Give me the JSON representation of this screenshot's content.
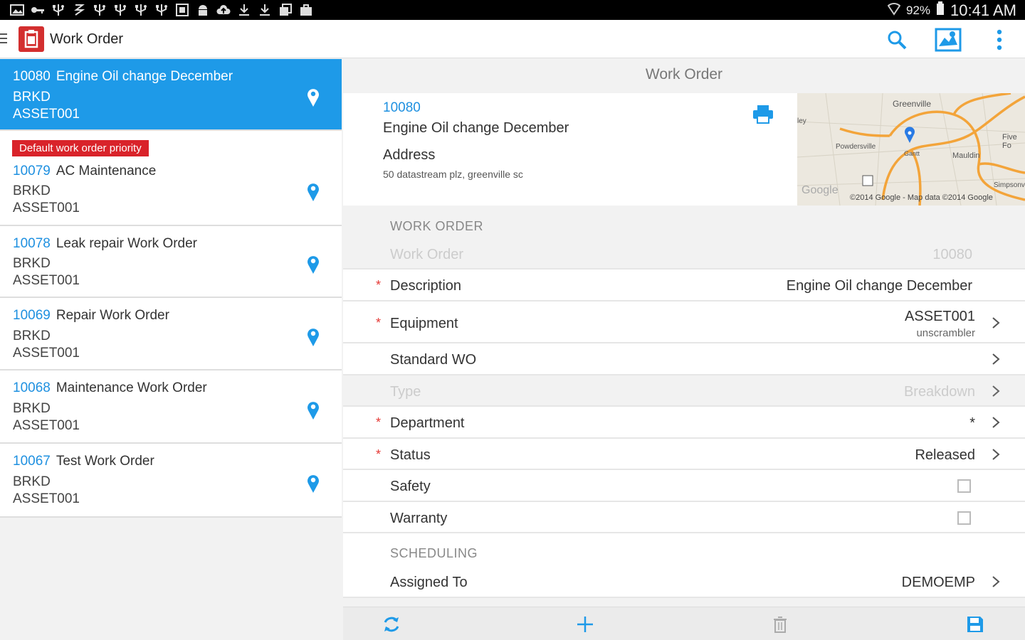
{
  "statusbar": {
    "icons": [
      "gallery-icon",
      "key-icon",
      "usb-icon",
      "signal-icon",
      "usb-icon",
      "usb-icon",
      "usb-icon",
      "usb-icon",
      "screenshot-icon",
      "android-icon",
      "cloud-upload-icon",
      "download-icon",
      "download-icon",
      "copy-icon",
      "bag-icon"
    ],
    "battery": "92%",
    "time": "10:41 AM"
  },
  "actionbar": {
    "title": "Work Order",
    "actions": [
      "search-icon",
      "map-icon",
      "overflow-menu-icon"
    ]
  },
  "list": {
    "items": [
      {
        "number": "10080",
        "title": "Engine Oil change December",
        "line2": "BRKD",
        "line3": "ASSET001",
        "selected": true
      },
      {
        "number": "10079",
        "title": "AC Maintenance",
        "line2": "BRKD",
        "line3": "ASSET001",
        "badge": "Default work order priority"
      },
      {
        "number": "10078",
        "title": "Leak repair Work Order",
        "line2": "BRKD",
        "line3": "ASSET001"
      },
      {
        "number": "10069",
        "title": "Repair Work Order",
        "line2": "BRKD",
        "line3": "ASSET001"
      },
      {
        "number": "10068",
        "title": "Maintenance Work Order",
        "line2": "BRKD",
        "line3": "ASSET001"
      },
      {
        "number": "10067",
        "title": "Test Work Order",
        "line2": "BRKD",
        "line3": "ASSET001"
      }
    ]
  },
  "detail": {
    "title": "Work Order",
    "card": {
      "number": "10080",
      "description": "Engine Oil change December",
      "address_label": "Address",
      "address": "50 datastream plz, greenville sc",
      "map_labels": [
        "Greenville",
        "Powdersville",
        "Five Fo",
        "Mauldin",
        "Simpsonville",
        "Gantt",
        "ley",
        "Google",
        "©2014 Google - Map data ©2014 Google"
      ]
    },
    "section_work_order": "WORK ORDER",
    "fields": {
      "work_order": {
        "label": "Work Order",
        "value": "10080"
      },
      "description": {
        "label": "Description",
        "value": "Engine Oil change December"
      },
      "equipment": {
        "label": "Equipment",
        "value": "ASSET001",
        "sub": "unscrambler"
      },
      "standard_wo": {
        "label": "Standard WO",
        "value": ""
      },
      "type": {
        "label": "Type",
        "value": "Breakdown"
      },
      "department": {
        "label": "Department",
        "value": "*"
      },
      "status": {
        "label": "Status",
        "value": "Released"
      },
      "safety": {
        "label": "Safety",
        "checked": false
      },
      "warranty": {
        "label": "Warranty",
        "checked": false
      }
    },
    "section_scheduling": "SCHEDULING",
    "assigned_to": {
      "label": "Assigned To",
      "value": "DEMOEMP"
    },
    "required_marker": "*"
  },
  "bottombar": {
    "actions": [
      "refresh-icon",
      "add-icon",
      "delete-icon",
      "save-icon"
    ]
  },
  "colors": {
    "accent": "#1e9ae8",
    "brand": "#d32f2f",
    "priority_badge": "#d9232a",
    "statusbar": "#000000"
  }
}
